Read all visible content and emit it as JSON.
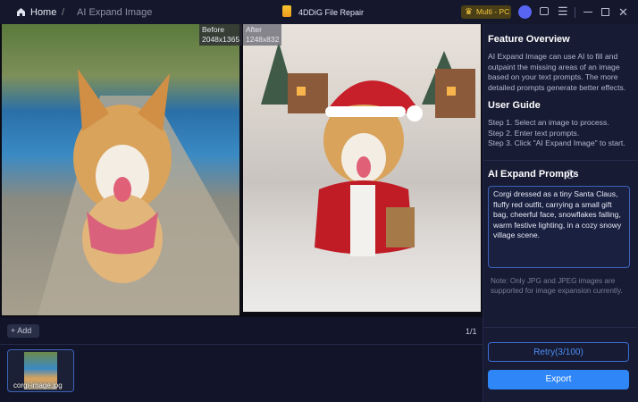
{
  "titlebar": {
    "home": "Home",
    "separator": "/",
    "breadcrumb": "AI Expand Image",
    "app_title": "4DDiG File Repair",
    "license": "Multi - PC"
  },
  "preview": {
    "before_label": "Before",
    "before_size": "2048x1365",
    "after_label": "After",
    "after_size": "1248x832"
  },
  "toolbar": {
    "add": "Add",
    "page": "1/1"
  },
  "thumbnails": [
    {
      "name": "corgi-image.jpg"
    }
  ],
  "panel": {
    "overview_title": "Feature Overview",
    "overview_text": "AI Expand Image can use AI to fill and outpaint the missing areas of an image based on your text prompts. The more detailed prompts generate better effects.",
    "guide_title": "User Guide",
    "steps": [
      "Step 1. Select an image to process.",
      "Step 2. Enter text prompts.",
      "Step 3. Click \"AI Expand Image\" to start."
    ],
    "prompts_title": "AI Expand Prompts",
    "prompt_value": "Corgi dressed as a tiny Santa Claus, fluffy red outfit, carrying a small gift bag, cheerful face, snowflakes falling, warm festive lighting, in a cozy snowy village scene.",
    "note": "Note: Only JPG and JPEG images are supported for image expansion currently.",
    "retry": "Retry(3/100)",
    "export": "Export"
  },
  "colors": {
    "accent": "#2f86f6",
    "background": "#12152a",
    "panel": "#171b33"
  }
}
